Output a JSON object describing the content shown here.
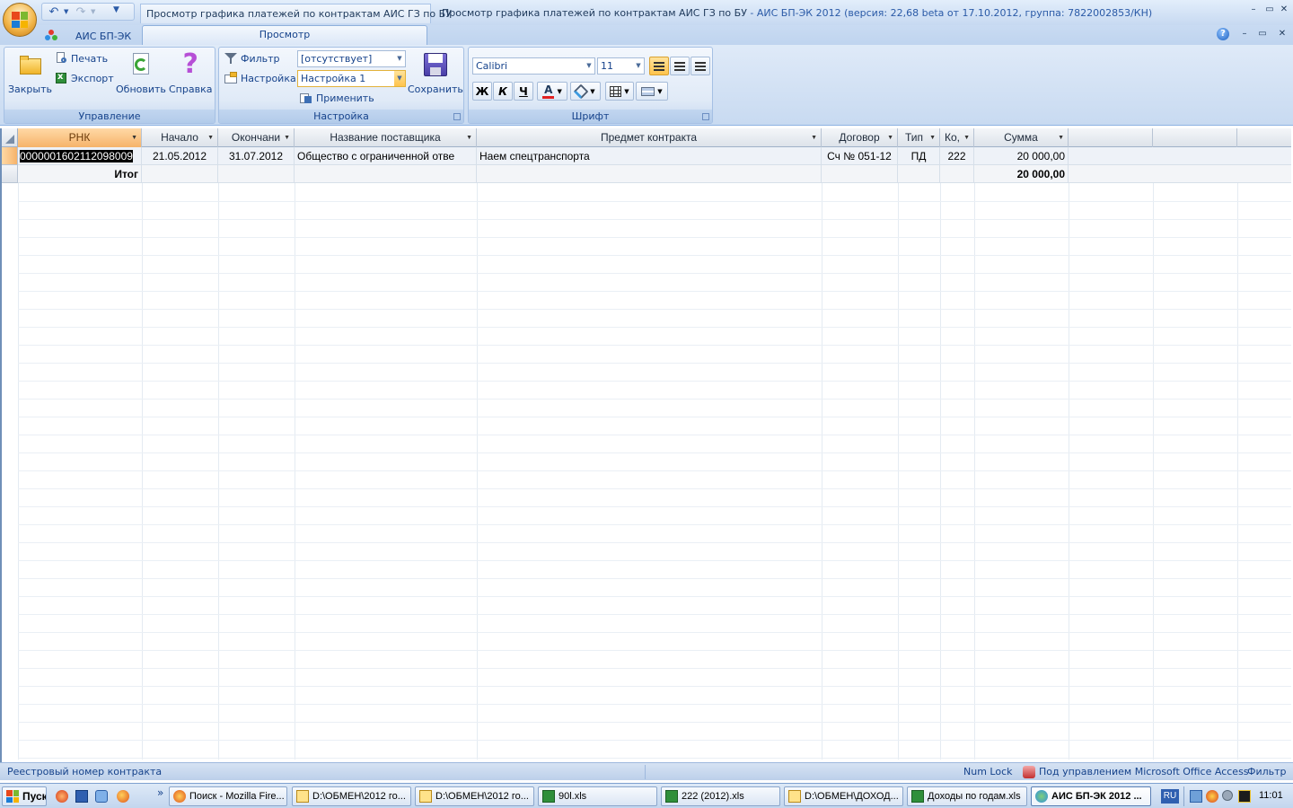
{
  "window": {
    "doc_tab_title": "Просмотр графика платежей по контрактам АИС ГЗ по БУ",
    "title_main": "Просмотр графика платежей по контрактам АИС ГЗ по БУ",
    "title_suffix": " - АИС БП-ЭК 2012 (версия: 22,68 beta от 17.10.2012, группа: 7822002853/КН)",
    "min": "–",
    "max": "▭",
    "close": "✕"
  },
  "ribbon_tabs": {
    "app_tab": "АИС БП-ЭК",
    "view_tab": "Просмотр",
    "help": "?"
  },
  "groups": {
    "manage": {
      "label": "Управление",
      "close": "Закрыть",
      "print": "Печать",
      "export": "Экспорт",
      "refresh": "Обновить",
      "help": "Справка"
    },
    "settings": {
      "label": "Настройка",
      "filter": "Фильтр",
      "filter_value": "[отсутствует]",
      "setting": "Настройка",
      "setting_value": "Настройка 1",
      "apply": "Применить",
      "save": "Сохранить"
    },
    "font": {
      "label": "Шрифт",
      "font_name": "Calibri",
      "font_size": "11",
      "bold": "Ж",
      "italic": "К",
      "underline": "Ч",
      "font_color_glyph": "A"
    }
  },
  "grid": {
    "columns": [
      "РНК",
      "Начало",
      "Окончани",
      "Название поставщика",
      "Предмет контракта",
      "Договор",
      "Тип",
      "Ко,",
      "Сумма"
    ],
    "rows": [
      {
        "rnk": "0000001602112098009",
        "start": "21.05.2012",
        "end": "31.07.2012",
        "supplier": "Общество с ограниченной отве",
        "subject": "Наем спецтранспорта",
        "contract": "Сч № 051-12",
        "type": "ПД",
        "code": "222",
        "sum": "20 000,00"
      }
    ],
    "total": {
      "label": "Итог",
      "sum": "20 000,00"
    }
  },
  "status": {
    "left": "Реестровый номер контракта",
    "numlock": "Num Lock",
    "managed": "Под управлением Microsoft Office Access",
    "filter": "Фильтр"
  },
  "taskbar": {
    "start": "Пуск",
    "overflow": "»",
    "items": [
      "Поиск - Mozilla Fire...",
      "D:\\ОБМЕН\\2012 го...",
      "D:\\ОБМЕН\\2012 го...",
      "90l.xls",
      "222 (2012).xls",
      "D:\\ОБМЕН\\ДОХОД...",
      "Доходы по годам.xls",
      "АИС БП-ЭК 2012 ..."
    ],
    "lang": "RU",
    "clock": "11:01"
  }
}
